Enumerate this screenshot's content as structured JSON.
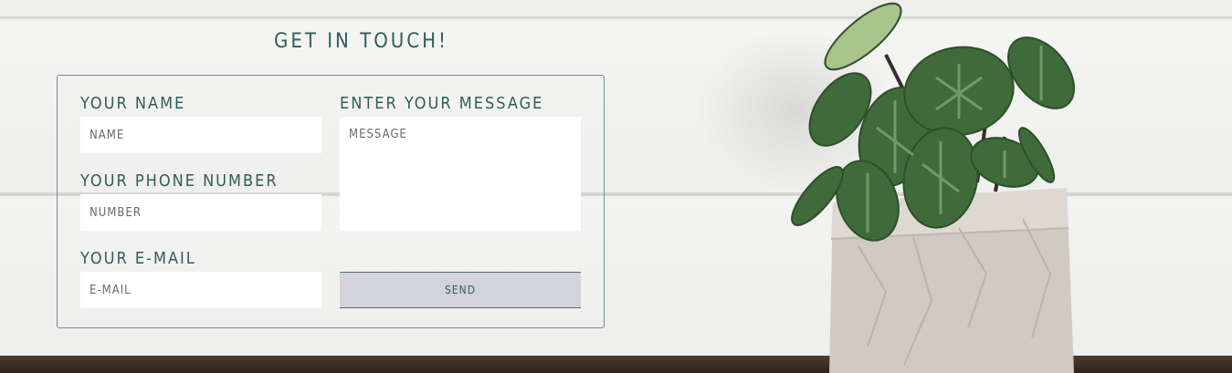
{
  "form": {
    "title": "GET IN TOUCH!",
    "name_label": "YOUR NAME",
    "name_placeholder": "NAME",
    "phone_label": "YOUR PHONE NUMBER",
    "phone_placeholder": "NUMBER",
    "email_label": "YOUR E-MAIL",
    "email_placeholder": "E-MAIL",
    "message_label": "ENTER YOUR MESSAGE",
    "message_placeholder": "MESSAGE",
    "send_label": "SEND"
  },
  "colors": {
    "accent": "#2f5d5a",
    "border": "#6f918c",
    "button_bg": "#d2d4d9",
    "table": "#3b2e24"
  },
  "decor": {
    "image": "potted-plant"
  }
}
